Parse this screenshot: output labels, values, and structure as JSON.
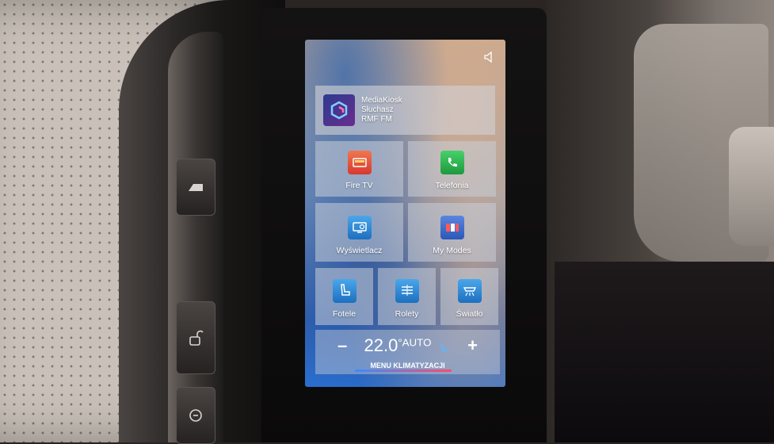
{
  "screen": {
    "media": {
      "line1": "MediaKiosk",
      "line2": "Słuchasz",
      "line3": "RMF FM"
    },
    "tiles": [
      {
        "label": "Fire TV",
        "icon": "fire-tv-icon",
        "color": "#e8553f"
      },
      {
        "label": "Telefonia",
        "icon": "phone-icon",
        "color": "#2db84c"
      },
      {
        "label": "Wyświetlacz",
        "icon": "display-icon",
        "color": "#2f8fd8"
      },
      {
        "label": "My Modes",
        "icon": "modes-icon",
        "color": "#3a6fd0"
      },
      {
        "label": "Fotele",
        "icon": "seat-icon",
        "color": "#2f8fd8"
      },
      {
        "label": "Rolety",
        "icon": "blinds-icon",
        "color": "#2f8fd8"
      },
      {
        "label": "Światło",
        "icon": "light-icon",
        "color": "#2f8fd8"
      }
    ],
    "climate": {
      "minus": "–",
      "plus": "+",
      "temperature": "22.0",
      "unit": "°",
      "mode": "AUTO",
      "label": "MENU KLIMATYZACJI"
    }
  }
}
